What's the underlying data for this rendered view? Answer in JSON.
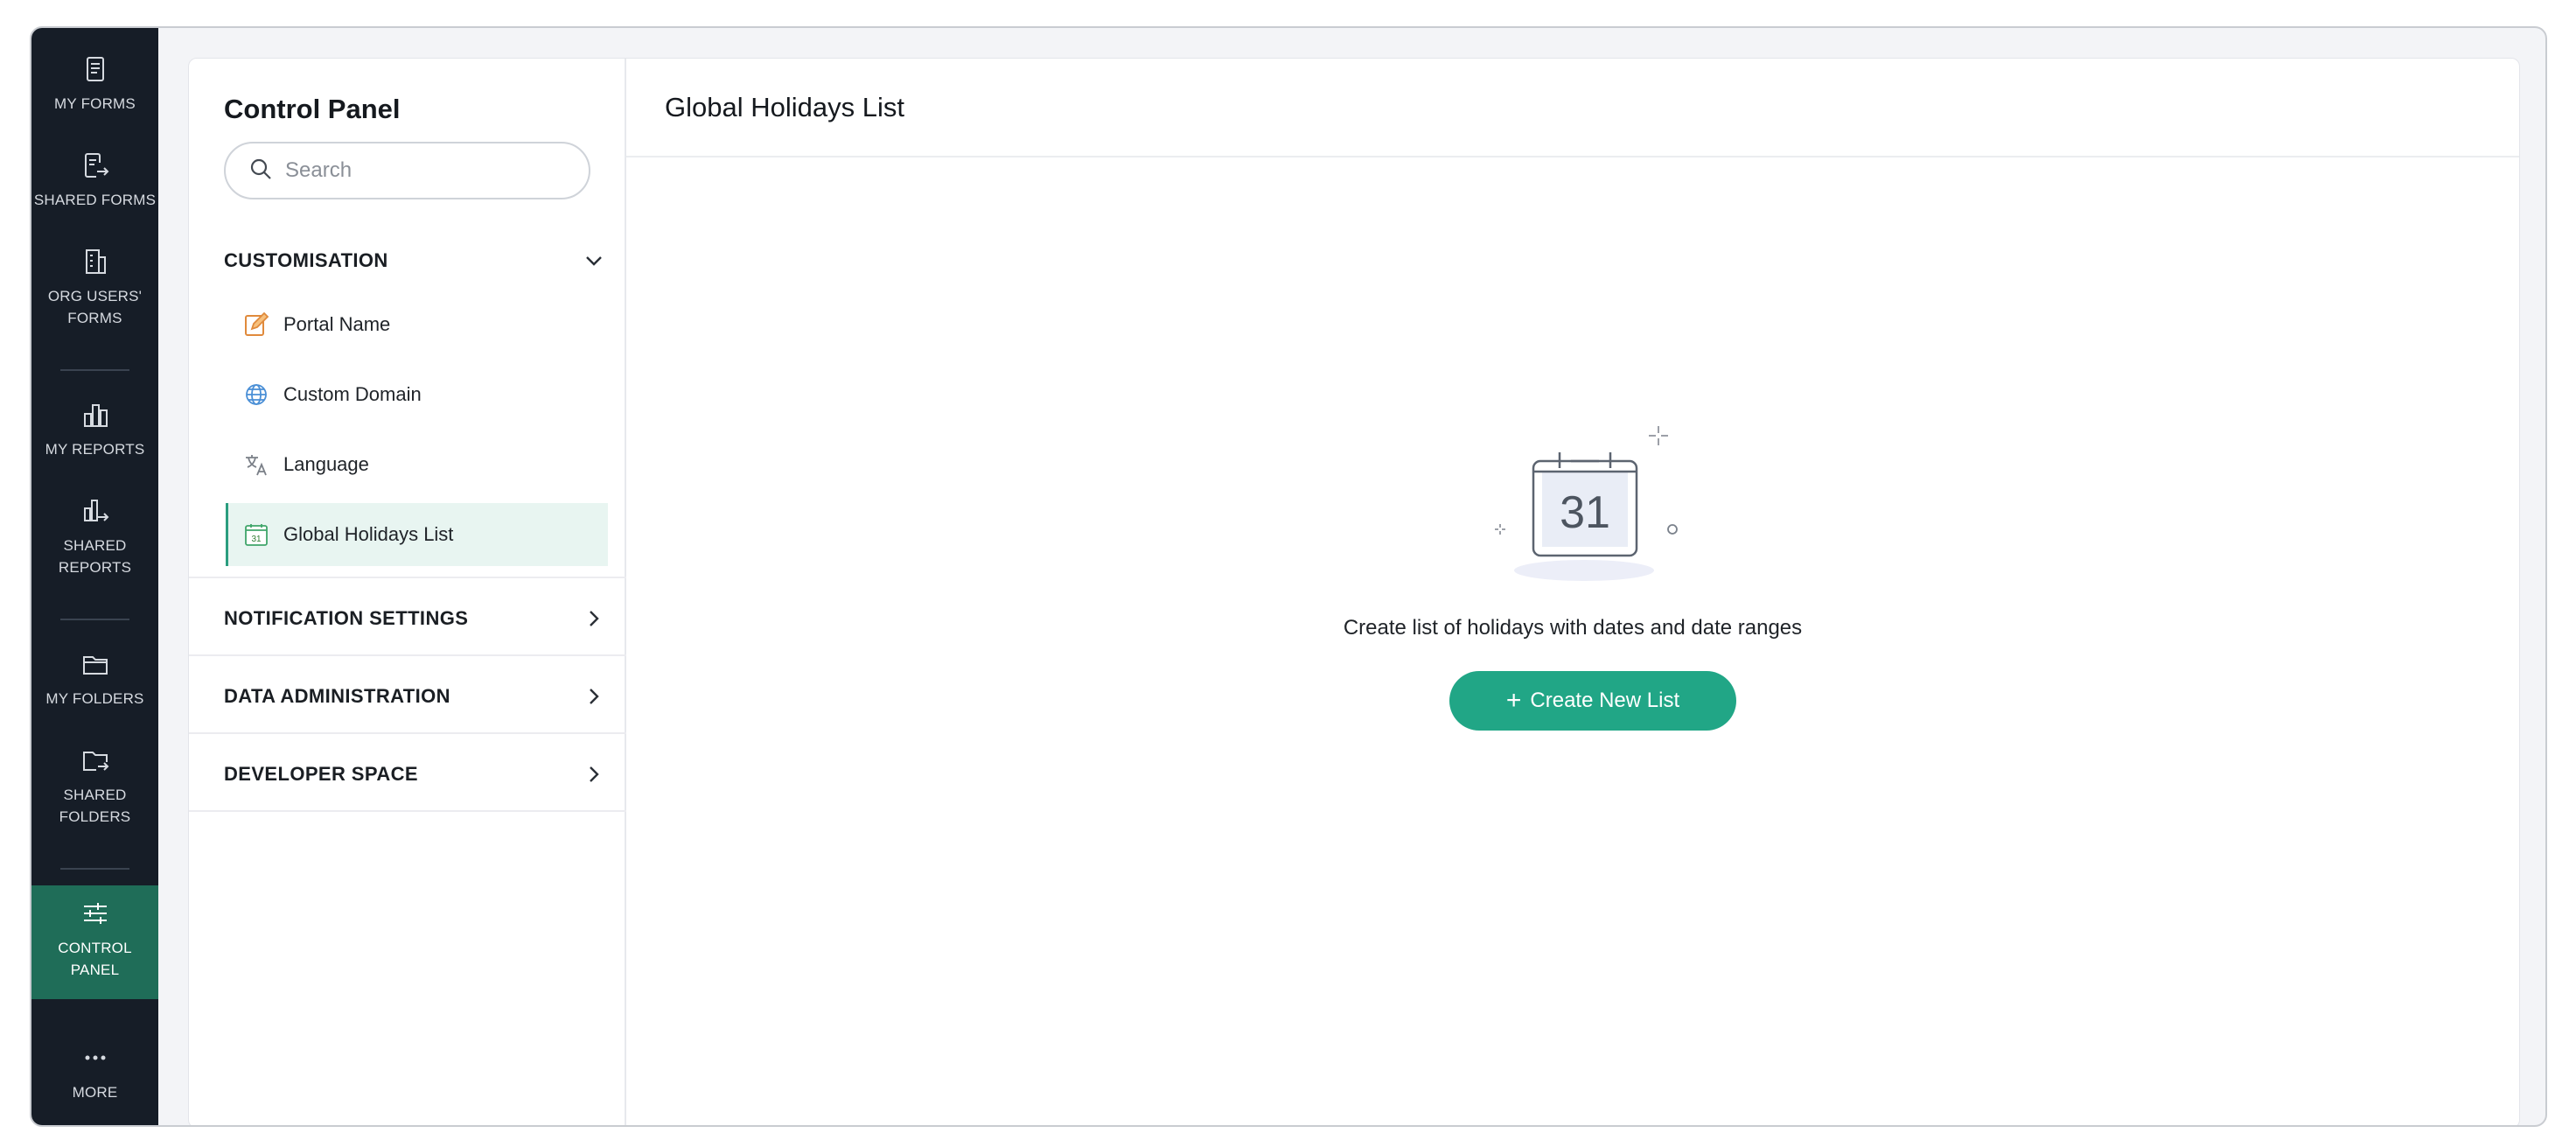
{
  "rail": {
    "items": [
      {
        "label": "MY FORMS",
        "icon": "form-icon"
      },
      {
        "label": "SHARED FORMS",
        "icon": "shared-form-icon"
      },
      {
        "label": "ORG USERS' FORMS",
        "icon": "building-icon"
      },
      {
        "label": "MY REPORTS",
        "icon": "bar-chart-icon"
      },
      {
        "label": "SHARED REPORTS",
        "icon": "shared-report-icon"
      },
      {
        "label": "MY FOLDERS",
        "icon": "folder-icon"
      },
      {
        "label": "SHARED FOLDERS",
        "icon": "shared-folder-icon"
      },
      {
        "label": "CONTROL PANEL",
        "icon": "sliders-icon",
        "active": true
      },
      {
        "label": "MORE",
        "icon": "more-dots-icon"
      }
    ]
  },
  "control_panel": {
    "title": "Control Panel",
    "search": {
      "placeholder": "Search",
      "value": ""
    },
    "sections": [
      {
        "label": "CUSTOMISATION",
        "expanded": true,
        "items": [
          {
            "label": "Portal Name",
            "icon": "edit-pencil-icon"
          },
          {
            "label": "Custom Domain",
            "icon": "globe-icon"
          },
          {
            "label": "Language",
            "icon": "translate-icon"
          },
          {
            "label": "Global Holidays List",
            "icon": "calendar-icon",
            "selected": true
          }
        ]
      },
      {
        "label": "NOTIFICATION SETTINGS",
        "expanded": false
      },
      {
        "label": "DATA ADMINISTRATION",
        "expanded": false
      },
      {
        "label": "DEVELOPER SPACE",
        "expanded": false
      }
    ]
  },
  "main": {
    "title": "Global Holidays List",
    "empty_state": {
      "calendar_day": "31",
      "message": "Create list of holidays with dates and date ranges",
      "button_label": "Create New List",
      "button_icon": "plus-icon"
    }
  },
  "colors": {
    "rail_bg": "#161d27",
    "rail_active": "#1f6d58",
    "accent": "#21a686",
    "selected_bg": "#e8f5f1"
  }
}
